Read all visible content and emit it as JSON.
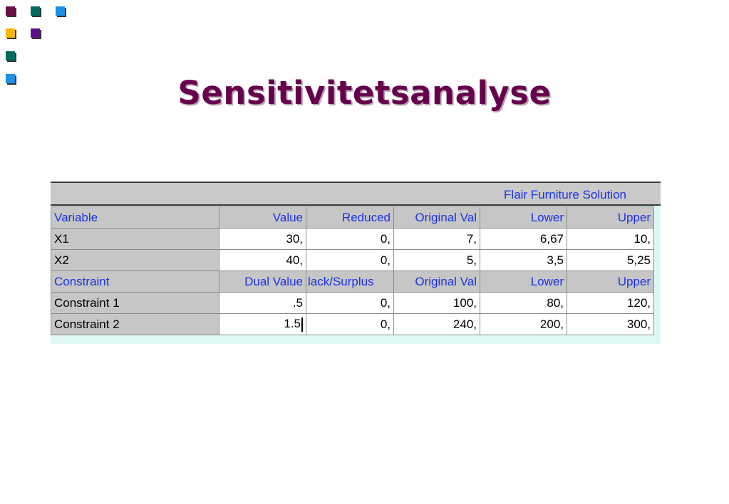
{
  "colors": {
    "title": "#66004d",
    "header_text": "#1a33e6",
    "bullet_maroon": "#6b0f45",
    "bullet_teal": "#006b5e",
    "bullet_blue": "#1e90e6",
    "bullet_yellow": "#f5b800",
    "bullet_purple": "#5a0f8c"
  },
  "icons": [
    "bullet-square-icon"
  ],
  "slide_title": "Sensitivitetsanalyse",
  "grid": {
    "solution_title": "Flair Furniture Solution",
    "variable_header": [
      "Variable",
      "Value",
      "Reduced",
      "Original Val",
      "Lower",
      "Upper"
    ],
    "variables": [
      [
        "X1",
        "30,",
        "0,",
        "7,",
        "6,67",
        "10,"
      ],
      [
        "X2",
        "40,",
        "0,",
        "5,",
        "3,5",
        "5,25"
      ]
    ],
    "constraint_header": [
      "Constraint",
      "Dual Value",
      "lack/Surplus",
      "Original Val",
      "Lower",
      "Upper"
    ],
    "constraints": [
      [
        "Constraint 1",
        ".5",
        "0,",
        "100,",
        "80,",
        "120,"
      ],
      [
        "Constraint 2",
        "1.5",
        "0,",
        "240,",
        "200,",
        "300,"
      ]
    ]
  }
}
